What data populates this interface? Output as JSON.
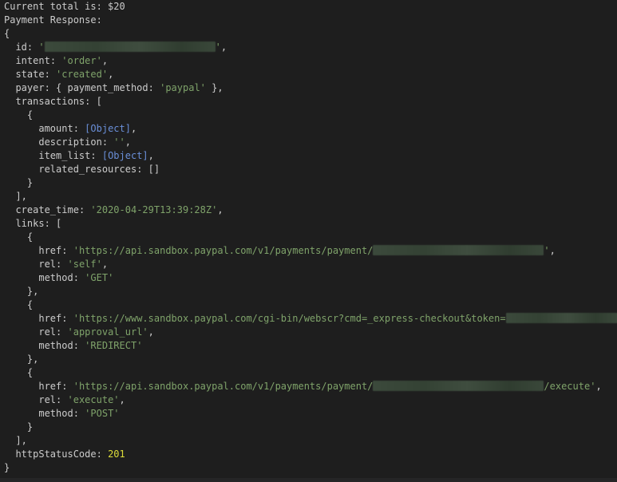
{
  "console": {
    "total_line": "Current total is: $20",
    "response_label": "Payment Response:",
    "open_brace": "{",
    "close_brace": "}",
    "id_key": "id",
    "intent_key": "intent",
    "intent_value": "'order'",
    "state_key": "state",
    "state_value": "'created'",
    "payer_key": "payer",
    "payment_method_key": "payment_method",
    "payment_method_value": "'paypal'",
    "transactions_key": "transactions",
    "amount_key": "amount",
    "amount_value": "[Object]",
    "description_key": "description",
    "description_value": "''",
    "item_list_key": "item_list",
    "item_list_value": "[Object]",
    "related_resources_key": "related_resources",
    "related_resources_value": "[]",
    "create_time_key": "create_time",
    "create_time_value": "'2020-04-29T13:39:28Z'",
    "links_key": "links",
    "href_key": "href",
    "rel_key": "rel",
    "method_key": "method",
    "link1_href_prefix": "'https://api.sandbox.paypal.com/v1/payments/payment/",
    "link1_href_suffix": "'",
    "link1_rel": "'self'",
    "link1_method": "'GET'",
    "link2_href_prefix": "'https://www.sandbox.paypal.com/cgi-bin/webscr?cmd=_express-checkout&token=",
    "link2_href_suffix": "'",
    "link2_rel": "'approval_url'",
    "link2_method": "'REDIRECT'",
    "link3_href_prefix": "'https://api.sandbox.paypal.com/v1/payments/payment/",
    "link3_href_suffix": "/execute'",
    "link3_rel": "'execute'",
    "link3_method": "'POST'",
    "http_status_key": "httpStatusCode",
    "http_status_value": "201"
  },
  "colors": {
    "background": "#1e1e1e",
    "text": "#cccccc",
    "string": "#7fa36a",
    "object_ref": "#6a8fd8",
    "number": "#dcdc3a"
  }
}
